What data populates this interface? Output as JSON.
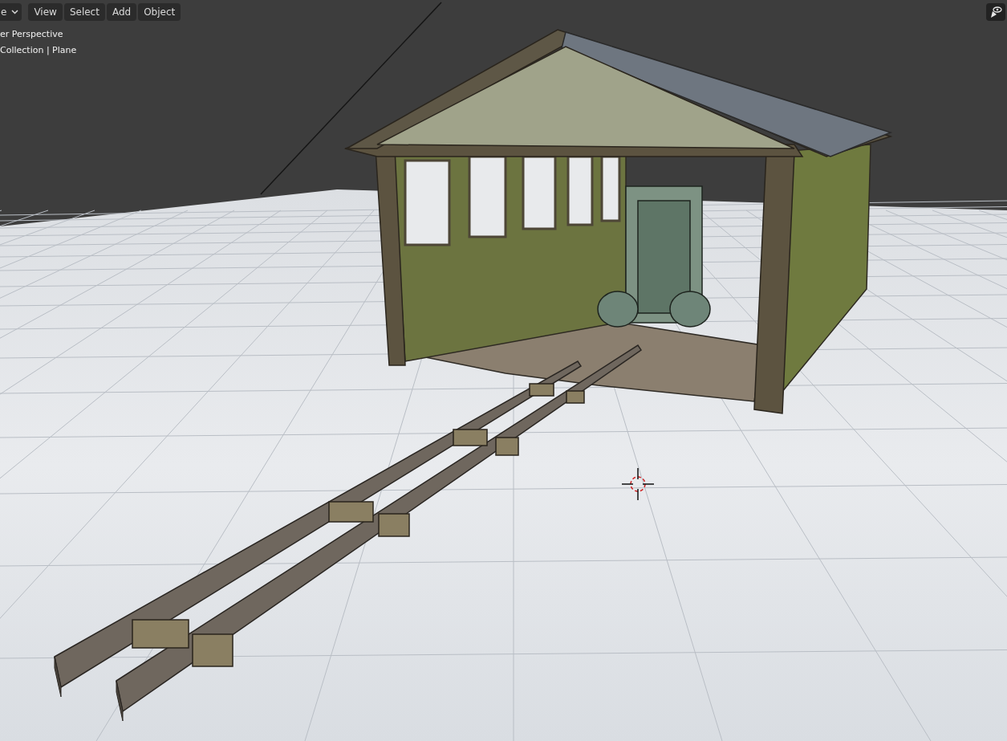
{
  "header": {
    "mode_dropdown": {
      "label": "e"
    },
    "menus": [
      {
        "label": "View"
      },
      {
        "label": "Select"
      },
      {
        "label": "Add"
      },
      {
        "label": "Object"
      }
    ]
  },
  "viewport_overlay": {
    "view_name": "er Perspective",
    "collection_info": "Collection | Plane"
  }
}
